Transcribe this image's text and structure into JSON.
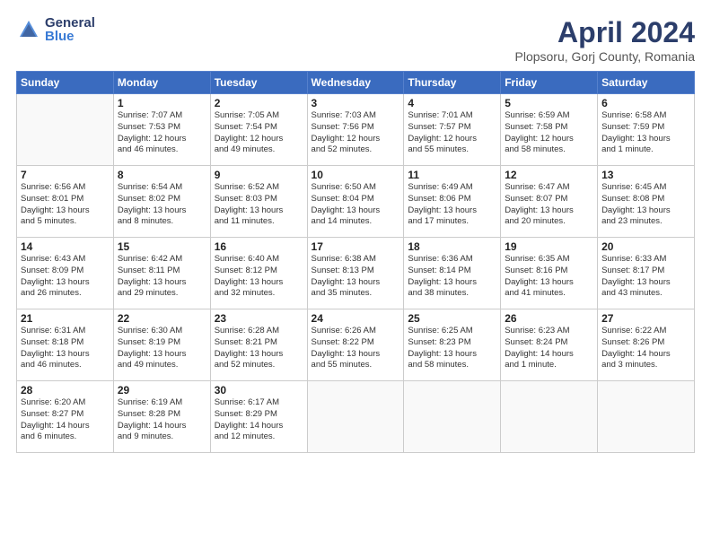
{
  "header": {
    "logo": {
      "general": "General",
      "blue": "Blue"
    },
    "title": "April 2024",
    "subtitle": "Plopsoru, Gorj County, Romania"
  },
  "calendar": {
    "weekdays": [
      "Sunday",
      "Monday",
      "Tuesday",
      "Wednesday",
      "Thursday",
      "Friday",
      "Saturday"
    ],
    "weeks": [
      [
        {
          "day": "",
          "info": ""
        },
        {
          "day": "1",
          "info": "Sunrise: 7:07 AM\nSunset: 7:53 PM\nDaylight: 12 hours\nand 46 minutes."
        },
        {
          "day": "2",
          "info": "Sunrise: 7:05 AM\nSunset: 7:54 PM\nDaylight: 12 hours\nand 49 minutes."
        },
        {
          "day": "3",
          "info": "Sunrise: 7:03 AM\nSunset: 7:56 PM\nDaylight: 12 hours\nand 52 minutes."
        },
        {
          "day": "4",
          "info": "Sunrise: 7:01 AM\nSunset: 7:57 PM\nDaylight: 12 hours\nand 55 minutes."
        },
        {
          "day": "5",
          "info": "Sunrise: 6:59 AM\nSunset: 7:58 PM\nDaylight: 12 hours\nand 58 minutes."
        },
        {
          "day": "6",
          "info": "Sunrise: 6:58 AM\nSunset: 7:59 PM\nDaylight: 13 hours\nand 1 minute."
        }
      ],
      [
        {
          "day": "7",
          "info": "Sunrise: 6:56 AM\nSunset: 8:01 PM\nDaylight: 13 hours\nand 5 minutes."
        },
        {
          "day": "8",
          "info": "Sunrise: 6:54 AM\nSunset: 8:02 PM\nDaylight: 13 hours\nand 8 minutes."
        },
        {
          "day": "9",
          "info": "Sunrise: 6:52 AM\nSunset: 8:03 PM\nDaylight: 13 hours\nand 11 minutes."
        },
        {
          "day": "10",
          "info": "Sunrise: 6:50 AM\nSunset: 8:04 PM\nDaylight: 13 hours\nand 14 minutes."
        },
        {
          "day": "11",
          "info": "Sunrise: 6:49 AM\nSunset: 8:06 PM\nDaylight: 13 hours\nand 17 minutes."
        },
        {
          "day": "12",
          "info": "Sunrise: 6:47 AM\nSunset: 8:07 PM\nDaylight: 13 hours\nand 20 minutes."
        },
        {
          "day": "13",
          "info": "Sunrise: 6:45 AM\nSunset: 8:08 PM\nDaylight: 13 hours\nand 23 minutes."
        }
      ],
      [
        {
          "day": "14",
          "info": "Sunrise: 6:43 AM\nSunset: 8:09 PM\nDaylight: 13 hours\nand 26 minutes."
        },
        {
          "day": "15",
          "info": "Sunrise: 6:42 AM\nSunset: 8:11 PM\nDaylight: 13 hours\nand 29 minutes."
        },
        {
          "day": "16",
          "info": "Sunrise: 6:40 AM\nSunset: 8:12 PM\nDaylight: 13 hours\nand 32 minutes."
        },
        {
          "day": "17",
          "info": "Sunrise: 6:38 AM\nSunset: 8:13 PM\nDaylight: 13 hours\nand 35 minutes."
        },
        {
          "day": "18",
          "info": "Sunrise: 6:36 AM\nSunset: 8:14 PM\nDaylight: 13 hours\nand 38 minutes."
        },
        {
          "day": "19",
          "info": "Sunrise: 6:35 AM\nSunset: 8:16 PM\nDaylight: 13 hours\nand 41 minutes."
        },
        {
          "day": "20",
          "info": "Sunrise: 6:33 AM\nSunset: 8:17 PM\nDaylight: 13 hours\nand 43 minutes."
        }
      ],
      [
        {
          "day": "21",
          "info": "Sunrise: 6:31 AM\nSunset: 8:18 PM\nDaylight: 13 hours\nand 46 minutes."
        },
        {
          "day": "22",
          "info": "Sunrise: 6:30 AM\nSunset: 8:19 PM\nDaylight: 13 hours\nand 49 minutes."
        },
        {
          "day": "23",
          "info": "Sunrise: 6:28 AM\nSunset: 8:21 PM\nDaylight: 13 hours\nand 52 minutes."
        },
        {
          "day": "24",
          "info": "Sunrise: 6:26 AM\nSunset: 8:22 PM\nDaylight: 13 hours\nand 55 minutes."
        },
        {
          "day": "25",
          "info": "Sunrise: 6:25 AM\nSunset: 8:23 PM\nDaylight: 13 hours\nand 58 minutes."
        },
        {
          "day": "26",
          "info": "Sunrise: 6:23 AM\nSunset: 8:24 PM\nDaylight: 14 hours\nand 1 minute."
        },
        {
          "day": "27",
          "info": "Sunrise: 6:22 AM\nSunset: 8:26 PM\nDaylight: 14 hours\nand 3 minutes."
        }
      ],
      [
        {
          "day": "28",
          "info": "Sunrise: 6:20 AM\nSunset: 8:27 PM\nDaylight: 14 hours\nand 6 minutes."
        },
        {
          "day": "29",
          "info": "Sunrise: 6:19 AM\nSunset: 8:28 PM\nDaylight: 14 hours\nand 9 minutes."
        },
        {
          "day": "30",
          "info": "Sunrise: 6:17 AM\nSunset: 8:29 PM\nDaylight: 14 hours\nand 12 minutes."
        },
        {
          "day": "",
          "info": ""
        },
        {
          "day": "",
          "info": ""
        },
        {
          "day": "",
          "info": ""
        },
        {
          "day": "",
          "info": ""
        }
      ]
    ]
  }
}
